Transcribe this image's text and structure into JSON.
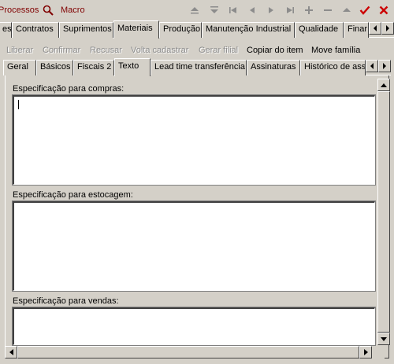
{
  "toolbar": {
    "processos_label": "Processos",
    "macro_label": "Macro",
    "icons": [
      "first-icon",
      "previous-icon",
      "next-icon",
      "last-icon",
      "add-icon",
      "remove-icon",
      "up-icon",
      "confirm-icon",
      "close-icon"
    ]
  },
  "main_tabs": [
    {
      "label": "es"
    },
    {
      "label": "Contratos"
    },
    {
      "label": "Suprimentos"
    },
    {
      "label": "Materiais",
      "active": true
    },
    {
      "label": "Produção"
    },
    {
      "label": "Manutenção Industrial"
    },
    {
      "label": "Qualidade"
    },
    {
      "label": "Finar"
    }
  ],
  "actions": {
    "liberar": "Liberar",
    "confirmar": "Confirmar",
    "recusar": "Recusar",
    "volta_cadastrar": "Volta cadastrar",
    "gerar_filial": "Gerar filial",
    "copiar_do_item": "Copiar do item",
    "move_familia": "Move família"
  },
  "sub_tabs": [
    {
      "label": "Geral"
    },
    {
      "label": "Básicos"
    },
    {
      "label": "Fiscais 2"
    },
    {
      "label": "Texto",
      "active": true
    },
    {
      "label": "Lead time transferência"
    },
    {
      "label": "Assinaturas"
    },
    {
      "label": "Histórico de ass"
    }
  ],
  "sections": {
    "compras": {
      "label": "Especificação para compras:",
      "value": ""
    },
    "estocagem": {
      "label": "Especificação para estocagem:",
      "value": ""
    },
    "vendas": {
      "label": "Especificação para vendas:",
      "value": ""
    }
  },
  "colors": {
    "window_bg": "#d4d0c8",
    "accent_red": "#800000",
    "confirm_red": "#cc0000"
  }
}
